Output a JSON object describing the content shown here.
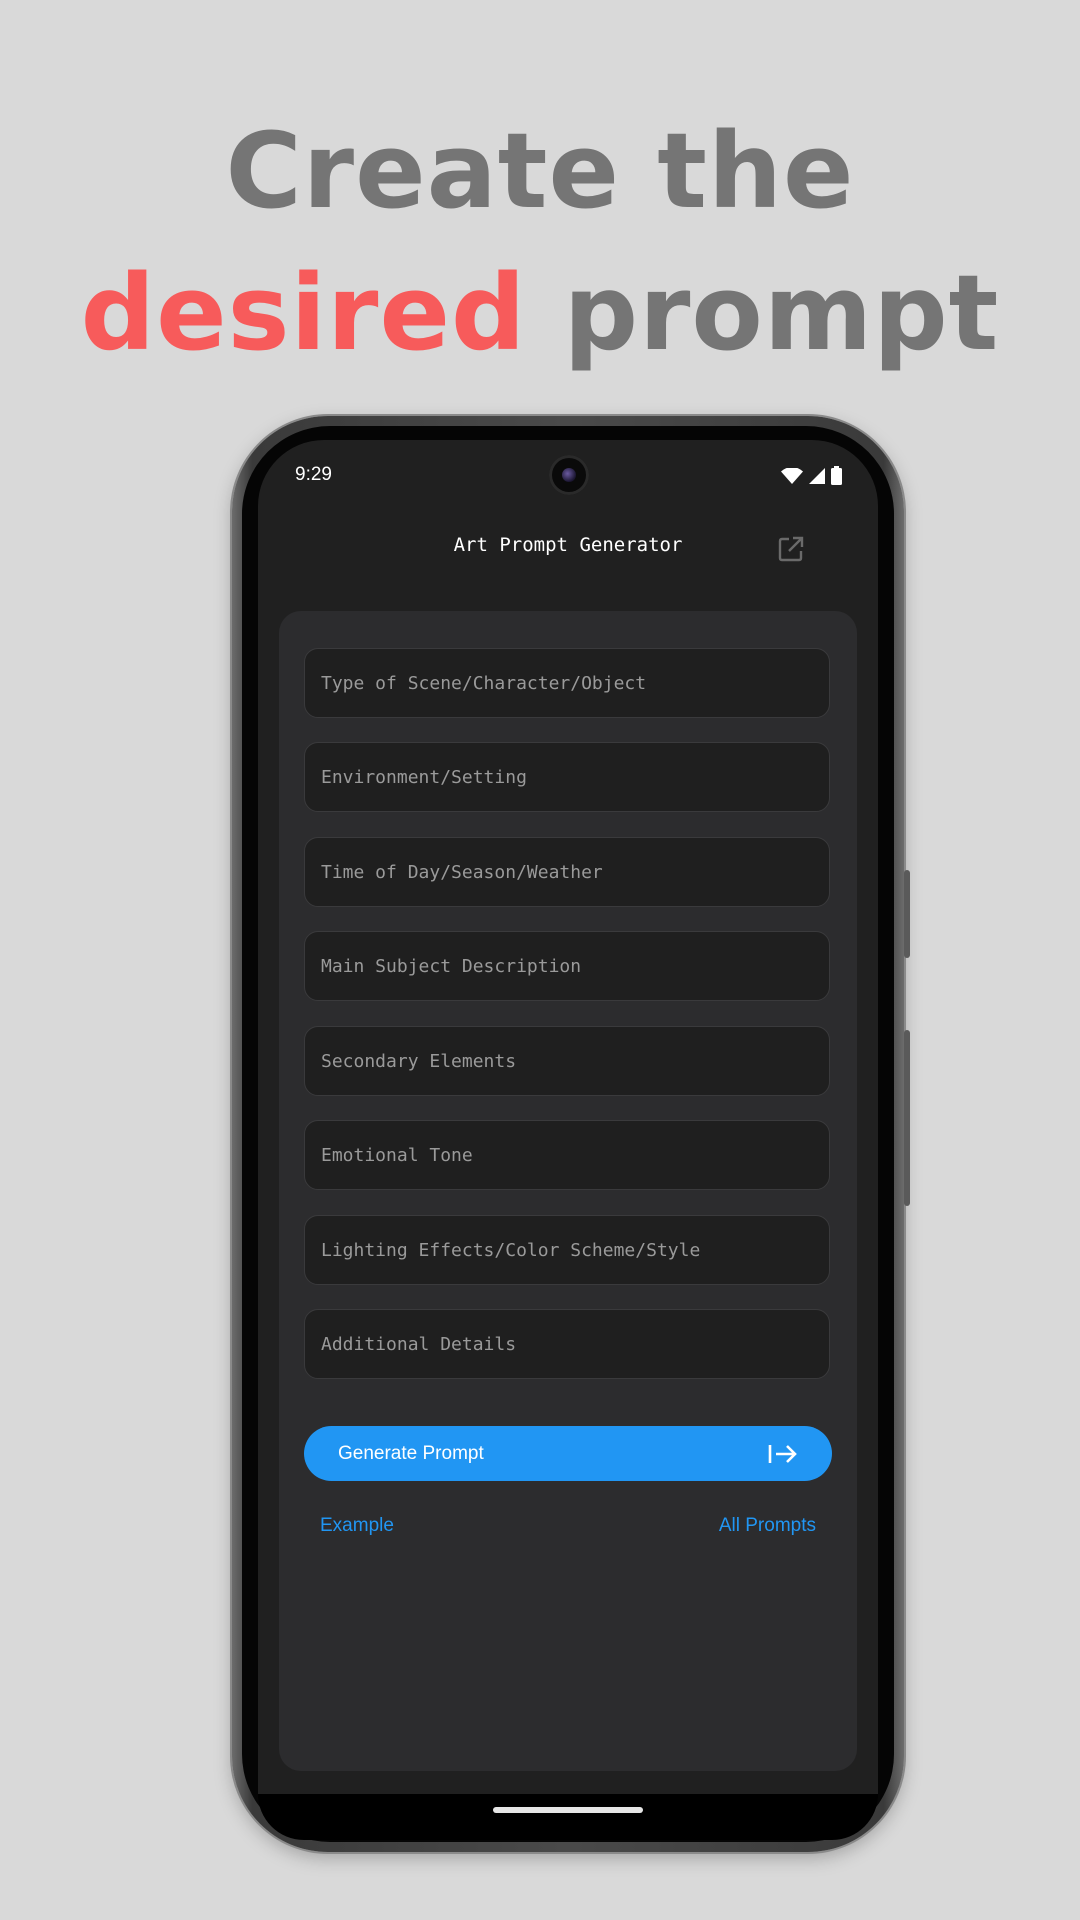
{
  "headline": {
    "line1": "Create the",
    "accent_word": "desired",
    "line2_rest": "prompt",
    "accent_color": "#f75b5b",
    "text_color": "#757575"
  },
  "status_bar": {
    "time": "9:29",
    "icons": [
      "wifi-icon",
      "signal-icon",
      "battery-icon"
    ]
  },
  "app_bar": {
    "title": "Art Prompt Generator",
    "action_icon": "open-external-icon"
  },
  "form": {
    "fields": [
      {
        "placeholder": "Type of Scene/Character/Object"
      },
      {
        "placeholder": "Environment/Setting"
      },
      {
        "placeholder": "Time of Day/Season/Weather"
      },
      {
        "placeholder": "Main Subject Description"
      },
      {
        "placeholder": "Secondary Elements"
      },
      {
        "placeholder": "Emotional Tone"
      },
      {
        "placeholder": "Lighting Effects/Color Scheme/Style"
      },
      {
        "placeholder": "Additional Details"
      }
    ],
    "generate_label": "Generate Prompt",
    "generate_icon": "arrow-right-to-bar-icon",
    "example_label": "Example",
    "all_prompts_label": "All Prompts",
    "accent_color": "#2196f3"
  }
}
